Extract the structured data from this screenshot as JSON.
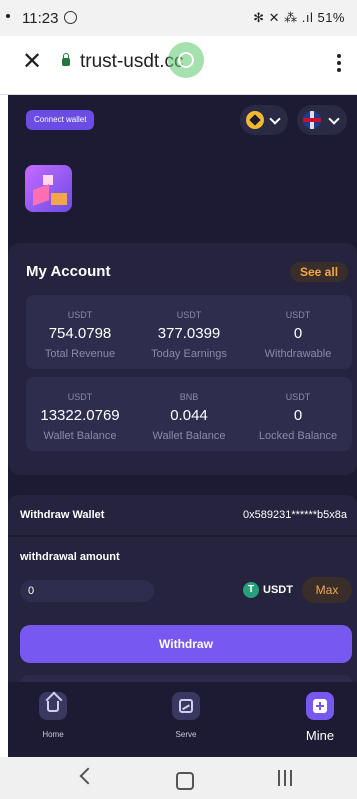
{
  "status_bar": {
    "time": "11:23",
    "right": "✻ ✕ ⁂ .ıl 51%"
  },
  "browser": {
    "url": "trust-usdt.cc"
  },
  "header": {
    "connect_label": "Connect wallet"
  },
  "account": {
    "title": "My Account",
    "see_all": "See all",
    "row1": [
      {
        "unit": "USDT",
        "value": "754.0798",
        "label": "Total Revenue"
      },
      {
        "unit": "USDT",
        "value": "377.0399",
        "label": "Today Earnings"
      },
      {
        "unit": "USDT",
        "value": "0",
        "label": "Withdrawable"
      }
    ],
    "row2": [
      {
        "unit": "USDT",
        "value": "13322.0769",
        "label": "Wallet Balance"
      },
      {
        "unit": "BNB",
        "value": "0.044",
        "label": "Wallet Balance"
      },
      {
        "unit": "USDT",
        "value": "0",
        "label": "Locked Balance"
      }
    ]
  },
  "withdraw_wallet": {
    "label": "Withdraw Wallet",
    "address": "0x589231******b5x8a"
  },
  "withdraw_amount": {
    "label": "withdrawal amount",
    "value": "0",
    "currency": "USDT",
    "max": "Max",
    "button": "Withdraw"
  },
  "bottom_nav": [
    {
      "label": "Home",
      "icon": "home-icon"
    },
    {
      "label": "Serve",
      "icon": "chart-icon"
    },
    {
      "label": "Mine",
      "icon": "plus-icon"
    }
  ],
  "colors": {
    "background": "#1d1b33",
    "accent": "#7758f0",
    "gold": "#f5a64a"
  }
}
